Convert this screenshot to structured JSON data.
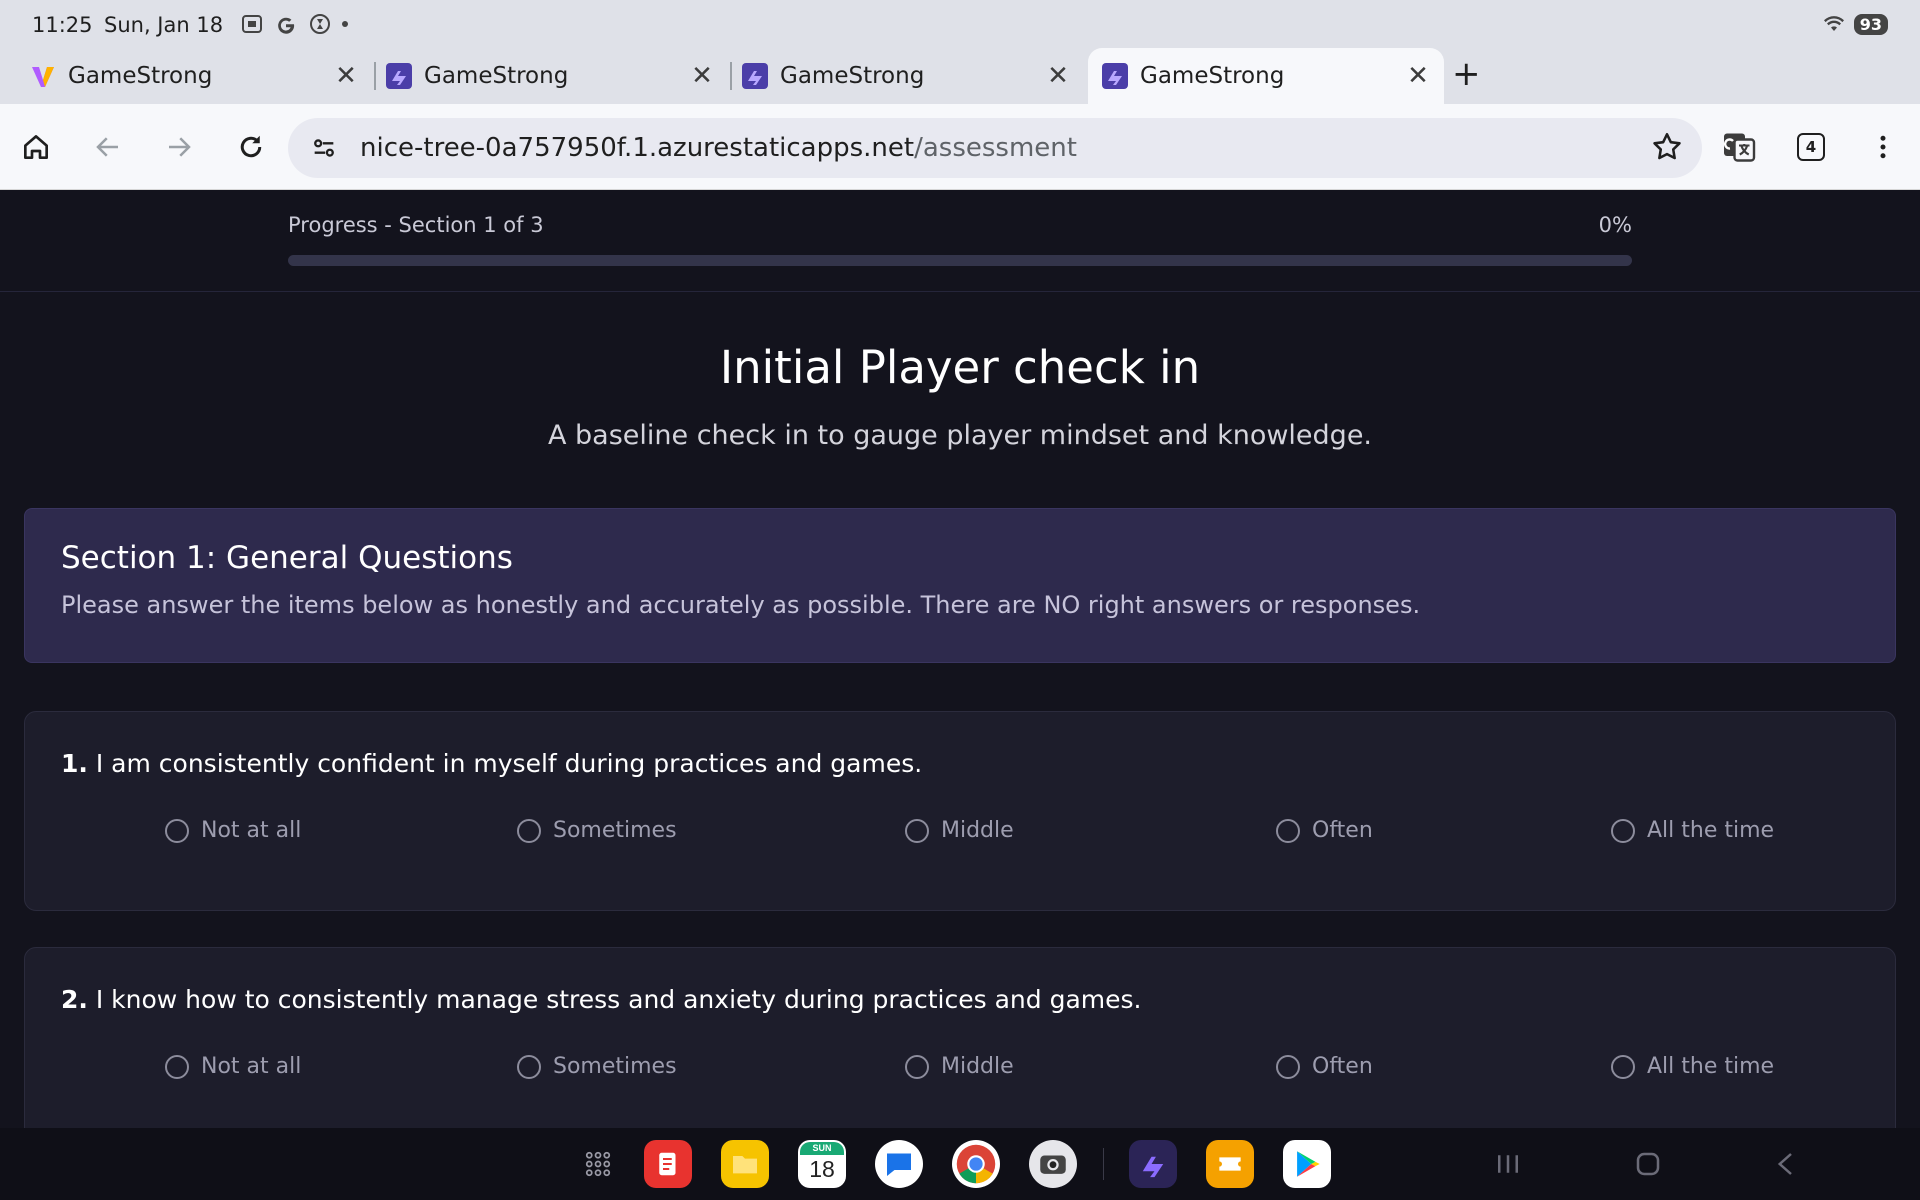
{
  "status_bar": {
    "time": "11:25",
    "date": "Sun, Jan 18",
    "battery": "93"
  },
  "browser": {
    "tabs": [
      {
        "title": "GameStrong",
        "favicon": "vee-logo-icon",
        "active": false
      },
      {
        "title": "GameStrong",
        "favicon": "gamestrong-logo-icon",
        "active": false
      },
      {
        "title": "GameStrong",
        "favicon": "gamestrong-logo-icon",
        "active": false
      },
      {
        "title": "GameStrong",
        "favicon": "gamestrong-logo-icon",
        "active": true
      }
    ],
    "url_host": "nice-tree-0a757950f.1.azurestaticapps.net",
    "url_path": "/assessment",
    "tab_count": "4"
  },
  "progress": {
    "label": "Progress - Section 1 of 3",
    "percent_text": "0%",
    "value": 0
  },
  "page": {
    "title": "Initial Player check in",
    "subtitle": "A baseline check in to gauge player mindset and knowledge."
  },
  "section": {
    "title": "Section 1: General Questions",
    "description": "Please answer the items below as honestly and accurately as possible. There are NO right answers or responses."
  },
  "questions": [
    {
      "number": "1.",
      "text": " I am consistently confident in myself during practices and games.",
      "options": [
        "Not at all",
        "Sometimes",
        "Middle",
        "Often",
        "All the time"
      ]
    },
    {
      "number": "2.",
      "text": " I know how to consistently manage stress and anxiety during practices and games.",
      "options": [
        "Not at all",
        "Sometimes",
        "Middle",
        "Often",
        "All the time"
      ]
    }
  ],
  "taskbar": {
    "calendar_day": "18",
    "calendar_dow": "SUN"
  },
  "colors": {
    "accent": "#7a5cff",
    "page_bg": "#13131d",
    "section_bg": "#2e2a4d",
    "card_bg": "#1d1d2b"
  }
}
